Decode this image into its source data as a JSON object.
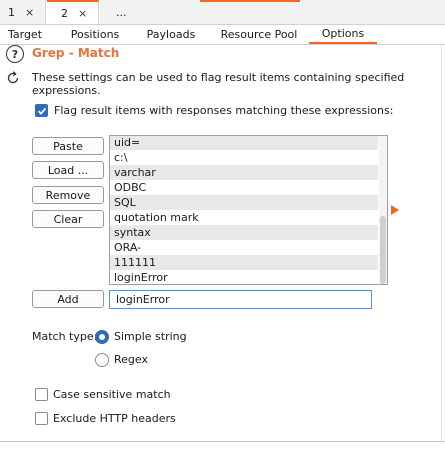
{
  "request_tabs": [
    {
      "label": "1",
      "close": "×"
    },
    {
      "label": "2",
      "close": "×"
    },
    {
      "label": "..."
    }
  ],
  "tool_tabs": [
    "Target",
    "Positions",
    "Payloads",
    "Resource Pool",
    "Options"
  ],
  "active_tool_tab": "Options",
  "section": {
    "help_glyph": "?",
    "title": "Grep - Match",
    "description": "These settings can be used to flag result items containing specified expressions."
  },
  "flag_checkbox": {
    "label": "Flag result items with responses matching these expressions:",
    "checked": true
  },
  "buttons": {
    "paste": "Paste",
    "load": "Load ...",
    "remove": "Remove",
    "clear": "Clear",
    "add": "Add"
  },
  "expressions": [
    "uid=",
    "c:\\",
    "varchar",
    "ODBC",
    "SQL",
    "quotation mark",
    "syntax",
    "ORA-",
    "111111",
    "loginError"
  ],
  "new_expression": "loginError",
  "match_type": {
    "label": "Match type:",
    "options": [
      "Simple string",
      "Regex"
    ],
    "selected": "Simple string"
  },
  "case_sensitive": {
    "label": "Case sensitive match",
    "checked": false
  },
  "exclude_headers": {
    "label": "Exclude HTTP headers",
    "checked": false
  },
  "colors": {
    "accent": "#f26522",
    "title": "#e8743b",
    "checkbox": "#2d6db5"
  }
}
